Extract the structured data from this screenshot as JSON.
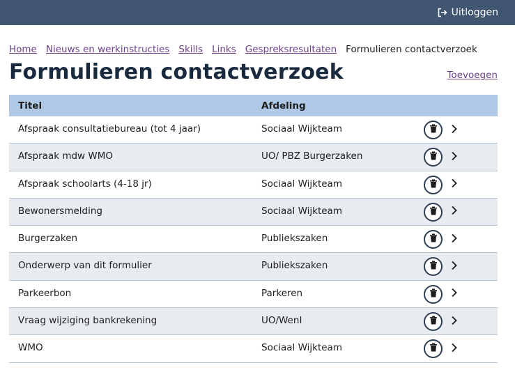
{
  "header": {
    "logout_label": "Uitloggen"
  },
  "breadcrumb": [
    {
      "label": "Home"
    },
    {
      "label": "Nieuws en werkinstructies"
    },
    {
      "label": "Skills"
    },
    {
      "label": "Links"
    },
    {
      "label": "Gespreksresultaten"
    }
  ],
  "breadcrumb_current": "Formulieren contactverzoek",
  "page": {
    "title": "Formulieren contactverzoek",
    "add_label": "Toevoegen"
  },
  "table": {
    "columns": {
      "title": "Titel",
      "department": "Afdeling"
    },
    "rows": [
      {
        "title": "Afspraak consultatiebureau (tot 4 jaar)",
        "department": "Sociaal Wijkteam"
      },
      {
        "title": "Afspraak mdw WMO",
        "department": "UO/ PBZ Burgerzaken"
      },
      {
        "title": "Afspraak schoolarts (4-18 jr)",
        "department": "Sociaal Wijkteam"
      },
      {
        "title": "Bewonersmelding",
        "department": "Sociaal Wijkteam"
      },
      {
        "title": "Burgerzaken",
        "department": "Publiekszaken"
      },
      {
        "title": "Onderwerp van dit formulier",
        "department": "Publiekszaken"
      },
      {
        "title": "Parkeerbon",
        "department": "Parkeren"
      },
      {
        "title": "Vraag wijziging bankrekening",
        "department": "UO/WenI"
      },
      {
        "title": "WMO",
        "department": "Sociaal Wijkteam"
      }
    ]
  },
  "icons": {
    "logout": "logout-icon",
    "delete": "trash-icon",
    "open": "chevron-right-icon"
  },
  "colors": {
    "topbar": "#3f5570",
    "table_header": "#aec8e6",
    "link": "#6b3f87",
    "row_alt": "#e8ebef"
  }
}
